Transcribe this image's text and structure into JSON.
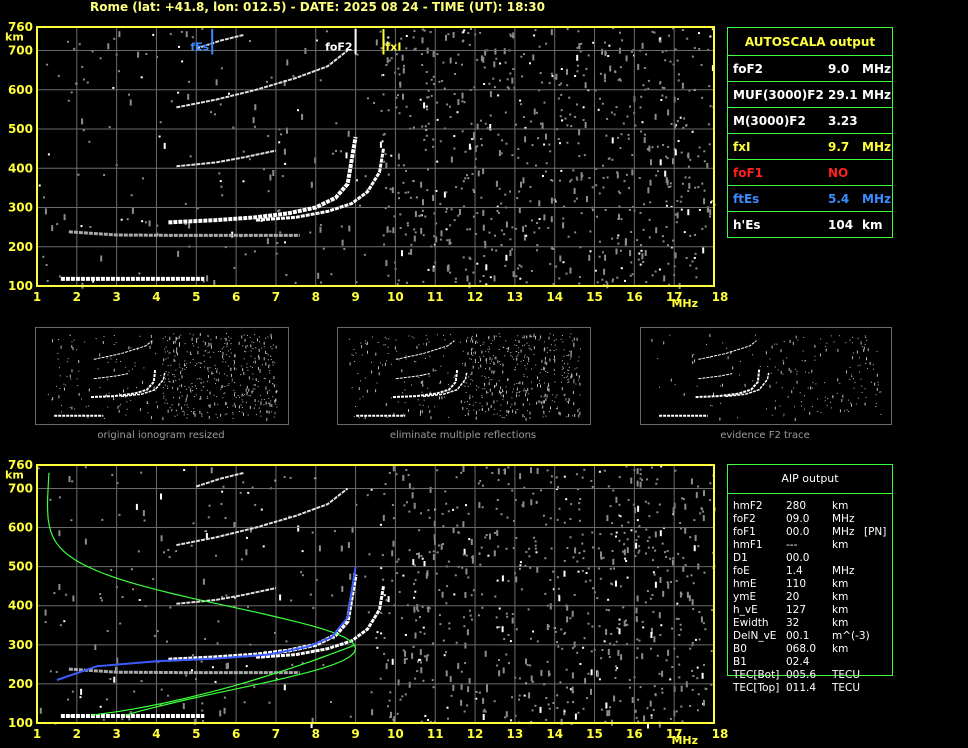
{
  "header": {
    "title": "Rome (lat: +41.8, lon: 012.5) - DATE: 2025 08 24 - TIME (UT): 18:30"
  },
  "autoscala": {
    "title": "AUTOSCALA output",
    "rows": [
      {
        "label": "foF2",
        "value": "9.0",
        "unit": "MHz",
        "color": "#ffffff"
      },
      {
        "label": "MUF(3000)F2",
        "value": "29.1",
        "unit": "MHz",
        "color": "#ffffff"
      },
      {
        "label": "M(3000)F2",
        "value": "3.23",
        "unit": "",
        "color": "#ffffff"
      },
      {
        "label": "fxI",
        "value": "9.7",
        "unit": "MHz",
        "color": "#ffff3c"
      },
      {
        "label": "foF1",
        "value": "NO",
        "unit": "",
        "color": "#ff2020"
      },
      {
        "label": "ftEs",
        "value": "5.4",
        "unit": "MHz",
        "color": "#3c8cff"
      },
      {
        "label": "h'Es",
        "value": "104",
        "unit": "km",
        "color": "#ffffff"
      }
    ]
  },
  "aip": {
    "title": "AIP output",
    "rows": [
      {
        "label": "hmF2",
        "value": "280",
        "unit": "km",
        "extra": ""
      },
      {
        "label": "foF2",
        "value": "09.0",
        "unit": "MHz",
        "extra": ""
      },
      {
        "label": "foF1",
        "value": "00.0",
        "unit": "MHz",
        "extra": "[PN]"
      },
      {
        "label": "hmF1",
        "value": "---",
        "unit": "km",
        "extra": ""
      },
      {
        "label": "D1",
        "value": "00.0",
        "unit": "",
        "extra": ""
      },
      {
        "label": "foE",
        "value": "1.4",
        "unit": "MHz",
        "extra": ""
      },
      {
        "label": "hmE",
        "value": "110",
        "unit": "km",
        "extra": ""
      },
      {
        "label": "ymE",
        "value": "20",
        "unit": "km",
        "extra": ""
      },
      {
        "label": "h_vE",
        "value": "127",
        "unit": "km",
        "extra": ""
      },
      {
        "label": "Ewidth",
        "value": "32",
        "unit": "km",
        "extra": ""
      },
      {
        "label": "DelN_vE",
        "value": "00.1",
        "unit": "m^(-3)",
        "extra": ""
      },
      {
        "label": "B0",
        "value": "068.0",
        "unit": "km",
        "extra": ""
      },
      {
        "label": "B1",
        "value": "02.4",
        "unit": "",
        "extra": ""
      },
      {
        "label": "TEC[Bot]",
        "value": "005.6",
        "unit": "TECU",
        "extra": ""
      },
      {
        "label": "TEC[Top]",
        "value": "011.4",
        "unit": "TECU",
        "extra": ""
      }
    ]
  },
  "thumbnails": [
    {
      "caption": "original ionogram resized"
    },
    {
      "caption": "eliminate multiple reflections"
    },
    {
      "caption": "evidence F2 trace"
    }
  ],
  "chart_data": [
    {
      "type": "scatter",
      "name": "autoscala-ionogram",
      "xlabel": "MHz",
      "ylabel": "km",
      "xlim": [
        1,
        18
      ],
      "ylim": [
        100,
        760
      ],
      "xticks": [
        1,
        2,
        3,
        4,
        5,
        6,
        7,
        8,
        9,
        10,
        11,
        12,
        13,
        14,
        15,
        16,
        17,
        18
      ],
      "yticks": [
        100,
        200,
        300,
        400,
        500,
        600,
        700,
        760
      ],
      "markers": [
        {
          "label": "fEs",
          "x": 5.4,
          "color": "#3c8cff"
        },
        {
          "label": "foF2",
          "x": 9.0,
          "color": "#ffffff"
        },
        {
          "label": "fxI",
          "x": 9.7,
          "color": "#ffff3c"
        }
      ],
      "traces": [
        {
          "kind": "Es",
          "x": [
            1.6,
            5.2
          ],
          "y": [
            118,
            118
          ]
        },
        {
          "kind": "F2o",
          "x": [
            4.3,
            5.5,
            6.5,
            7.3,
            8.0,
            8.5,
            8.8,
            9.0
          ],
          "y": [
            262,
            268,
            275,
            285,
            300,
            325,
            360,
            480
          ]
        },
        {
          "kind": "F2x",
          "x": [
            6.5,
            7.5,
            8.3,
            8.9,
            9.3,
            9.6,
            9.7
          ],
          "y": [
            268,
            275,
            290,
            310,
            340,
            390,
            450
          ]
        },
        {
          "kind": "E",
          "x": [
            1.6,
            3.0,
            4.5,
            6.0,
            7.5
          ],
          "y": [
            245,
            232,
            230,
            230,
            230
          ]
        }
      ]
    },
    {
      "type": "scatter",
      "name": "aip-ionogram",
      "xlabel": "MHz",
      "ylabel": "km",
      "xlim": [
        1,
        18
      ],
      "ylim": [
        100,
        760
      ],
      "xticks": [
        1,
        2,
        3,
        4,
        5,
        6,
        7,
        8,
        9,
        10,
        11,
        12,
        13,
        14,
        15,
        16,
        17,
        18
      ],
      "yticks": [
        100,
        200,
        300,
        400,
        500,
        600,
        700,
        760
      ],
      "profile_fit": {
        "x": [
          1.5,
          2.5,
          4.0,
          5.5,
          6.8,
          7.8,
          8.4,
          8.8,
          9.0
        ],
        "y": [
          210,
          245,
          258,
          265,
          275,
          295,
          320,
          370,
          500
        ]
      }
    }
  ]
}
